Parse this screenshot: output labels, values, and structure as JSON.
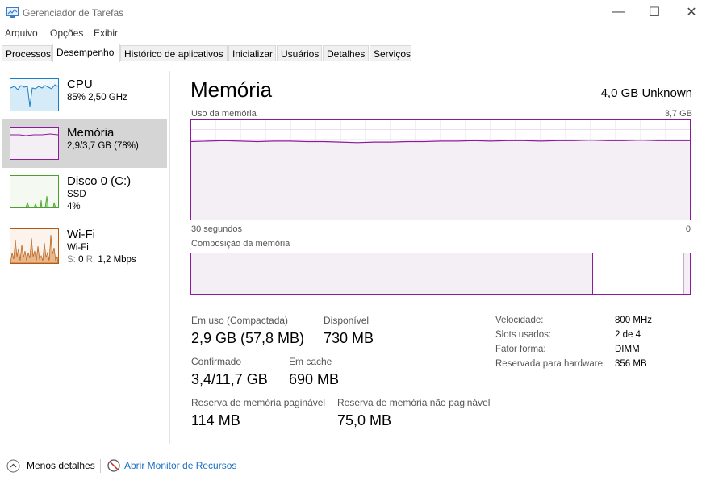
{
  "window": {
    "title": "Gerenciador de Tarefas",
    "minimize": "—",
    "maximize": "☐",
    "close": "✕"
  },
  "menu": [
    "Arquivo",
    "Opções",
    "Exibir"
  ],
  "tabs": [
    "Processos",
    "Desempenho",
    "Histórico de aplicativos",
    "Inicializar",
    "Usuários",
    "Detalhes",
    "Serviços"
  ],
  "active_tab": "Desempenho",
  "sidebar": [
    {
      "title": "CPU",
      "line1": "85%  2,50 GHz",
      "color": "#1a7fc4"
    },
    {
      "title": "Memória",
      "line1": "2,9/3,7 GB (78%)",
      "color": "#8b1b9a"
    },
    {
      "title": "Disco 0 (C:)",
      "line1": "SSD",
      "line2": "4%",
      "color": "#4aa02c"
    },
    {
      "title": "Wi-Fi",
      "line1": "Wi-Fi",
      "line2_s": "S:",
      "line2_s_val": "0",
      "line2_r": "R:",
      "line2_r_val": "1,2 Mbps",
      "color": "#b55a10"
    }
  ],
  "main": {
    "heading": "Memória",
    "total": "4,0 GB Unknown",
    "usage_label": "Uso da memória",
    "usage_max": "3,7 GB",
    "time_left": "30 segundos",
    "time_right": "0",
    "composition_label": "Composição da memória",
    "usage_fraction": 0.78,
    "composition": {
      "in_use_fraction": 0.806,
      "modified_fraction": 0.182
    },
    "stats": {
      "in_use_label": "Em uso (Compactada)",
      "in_use_value": "2,9 GB (57,8 MB)",
      "available_label": "Disponível",
      "available_value": "730 MB",
      "committed_label": "Confirmado",
      "committed_value": "3,4/11,7 GB",
      "cached_label": "Em cache",
      "cached_value": "690 MB",
      "paged_label": "Reserva de memória paginável",
      "paged_value": "114 MB",
      "nonpaged_label": "Reserva de memória não paginável",
      "nonpaged_value": "75,0 MB"
    },
    "details": [
      {
        "k": "Velocidade:",
        "v": "800 MHz"
      },
      {
        "k": "Slots usados:",
        "v": "2 de 4"
      },
      {
        "k": "Fator forma:",
        "v": "DIMM"
      },
      {
        "k": "Reservada para hardware:",
        "v": "356 MB"
      }
    ]
  },
  "footer": {
    "less_details": "Menos detalhes",
    "resource_monitor": "Abrir Monitor de Recursos"
  }
}
